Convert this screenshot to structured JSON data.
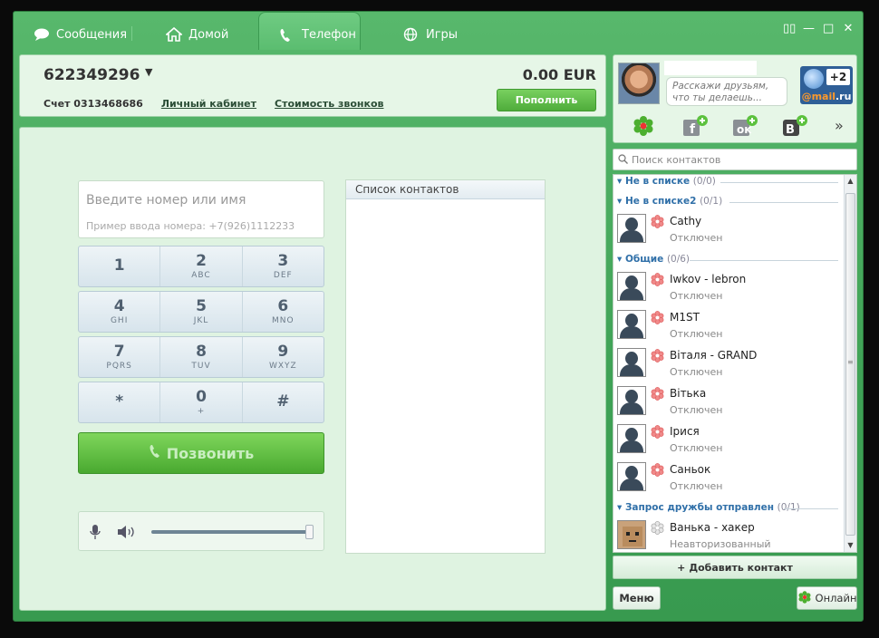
{
  "tabs": [
    {
      "label": "Сообщения",
      "icon": "chat-icon"
    },
    {
      "label": "Домой",
      "icon": "home-icon"
    },
    {
      "label": "Телефон",
      "icon": "phone-icon",
      "active": true
    },
    {
      "label": "Игры",
      "icon": "globe-icon"
    }
  ],
  "window_controls": [
    "▯▯",
    "—",
    "□",
    "✕"
  ],
  "account": {
    "number": "622349296",
    "balance": "0.00 EUR",
    "account_text": "Счет 0313468686",
    "cabinet_link": "Личный кабинет",
    "rates_link": "Стоимость звонков",
    "topup_label": "Пополнить"
  },
  "dialer": {
    "input_placeholder": "Введите номер или имя",
    "input_example": "Пример ввода номера: +7(926)1112233",
    "keys": [
      [
        {
          "d": "1",
          "l": ""
        },
        {
          "d": "2",
          "l": "ABC"
        },
        {
          "d": "3",
          "l": "DEF"
        }
      ],
      [
        {
          "d": "4",
          "l": "GHI"
        },
        {
          "d": "5",
          "l": "JKL"
        },
        {
          "d": "6",
          "l": "MNO"
        }
      ],
      [
        {
          "d": "7",
          "l": "PQRS"
        },
        {
          "d": "8",
          "l": "TUV"
        },
        {
          "d": "9",
          "l": "WXYZ"
        }
      ],
      [
        {
          "d": "*",
          "l": ""
        },
        {
          "d": "0",
          "l": "+"
        },
        {
          "d": "#",
          "l": ""
        }
      ]
    ],
    "call_label": "Позвонить",
    "volume_level": 0.95
  },
  "contact_list_panel": {
    "header": "Список контактов"
  },
  "profile": {
    "status_placeholder": "Расскажи друзьям, что ты делаешь...",
    "mailru_badge": "+2",
    "mailru_brand_at": "@mail",
    "mailru_brand_ru": ".ru"
  },
  "search": {
    "placeholder": "Поиск контактов"
  },
  "groups": [
    {
      "name": "Не в списке",
      "count": "(0/0)"
    },
    {
      "name": "Не в списке2",
      "count": "(0/1)"
    },
    {
      "name": "Общие",
      "count": "(0/6)"
    },
    {
      "name": "Запрос дружбы отправлен",
      "count": "(0/1)"
    }
  ],
  "contacts": [
    {
      "name": "Cathy",
      "status": "Отключен"
    },
    {
      "name": "Iwkov - lebron",
      "status": "Отключен"
    },
    {
      "name": "M1ST",
      "status": "Отключен"
    },
    {
      "name": "Віталя - GRAND",
      "status": "Отключен"
    },
    {
      "name": "Вітька",
      "status": "Отключен"
    },
    {
      "name": "Ірися",
      "status": "Отключен"
    },
    {
      "name": "Саньок",
      "status": "Отключен"
    },
    {
      "name": "Ванька - хакер",
      "status": "Неавторизованный"
    }
  ],
  "add_contact_label": "Добавить контакт",
  "menu_label": "Меню",
  "online_label": "Онлайн",
  "colors": {
    "brand_green": "#3fa256",
    "panel_bg": "#dff3e1",
    "link_blue": "#2f6fa8"
  }
}
